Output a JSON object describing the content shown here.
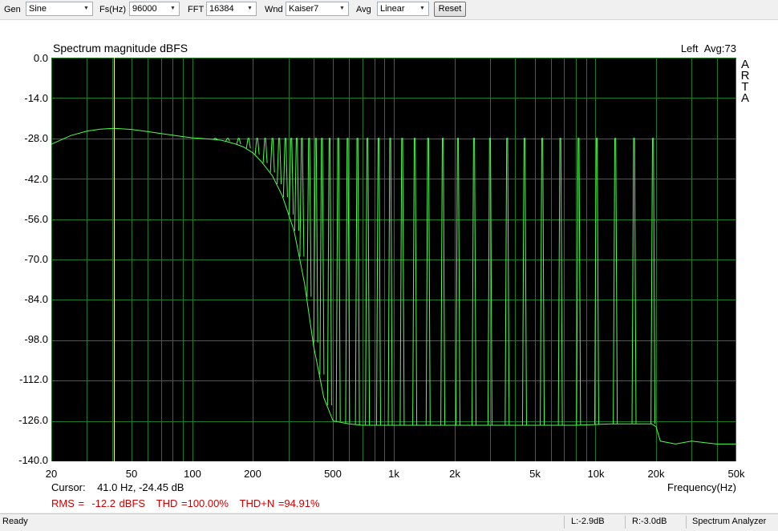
{
  "toolbar": {
    "gen_label": "Gen",
    "gen_value": "Sine",
    "fs_label": "Fs(Hz)",
    "fs_value": "96000",
    "fft_label": "FFT",
    "fft_value": "16384",
    "wnd_label": "Wnd",
    "wnd_value": "Kaiser7",
    "avg_label": "Avg",
    "avg_value": "Linear",
    "reset_label": "Reset"
  },
  "plot": {
    "title": "Spectrum magnitude dBFS",
    "channel": "Left",
    "avg": "Avg:73",
    "logo_letters": [
      "A",
      "R",
      "T",
      "A"
    ],
    "x_axis_label": "Frequency(Hz)",
    "cursor_readout": "Cursor:    41.0 Hz, -24.45 dB",
    "stats": "RMS =  -12.2 dBFS   THD =100.00%   THD+N =94.91%"
  },
  "colors": {
    "plot_bg": "#000000",
    "grid": "#1e7a1e",
    "trace": "#4cff4c",
    "cursor": "#ffff40",
    "stats_text": "#cc0000"
  },
  "chart_data": {
    "type": "line",
    "title": "Spectrum magnitude dBFS",
    "xlabel": "Frequency(Hz)",
    "ylabel": "",
    "x_scale": "log",
    "xlim": [
      20,
      50000
    ],
    "ylim": [
      -140,
      0
    ],
    "grid": true,
    "y_ticks": [
      "0.0",
      "-14.0",
      "-28.0",
      "-42.0",
      "-56.0",
      "-70.0",
      "-84.0",
      "-98.0",
      "-112.0",
      "-126.0",
      "-140.0"
    ],
    "x_ticks": [
      "20",
      "50",
      "100",
      "200",
      "500",
      "1k",
      "2k",
      "5k",
      "10k",
      "20k",
      "50k"
    ],
    "cursor": {
      "freq_hz": 41.0,
      "level_db": -24.45
    },
    "series": [
      {
        "x": [
          20,
          25,
          30,
          35,
          41,
          50,
          60,
          70,
          80,
          90,
          100,
          110,
          120,
          130,
          140,
          150,
          165,
          180,
          200,
          220,
          250,
          280,
          320,
          360,
          400,
          450,
          500,
          600,
          700,
          800,
          1000,
          1200,
          1500,
          2000,
          3000,
          5000,
          8000,
          12000,
          16000,
          19000,
          20000,
          21000,
          25000,
          30000,
          40000,
          50000
        ],
        "y": [
          -30,
          -27,
          -25.5,
          -24.8,
          -24.5,
          -24.9,
          -25.6,
          -26.3,
          -26.9,
          -27.4,
          -27.8,
          -28,
          -28.2,
          -28.4,
          -28.7,
          -29.2,
          -30,
          -31,
          -33,
          -36,
          -41,
          -48,
          -60,
          -78,
          -100,
          -118,
          -126,
          -127,
          -127.5,
          -127.5,
          -127.5,
          -127.5,
          -127.5,
          -127.5,
          -127.5,
          -127.5,
          -127.5,
          -127,
          -127,
          -127,
          -128,
          -133,
          -134,
          -133,
          -134,
          -134
        ]
      }
    ],
    "harmonics_hz": [
      130,
      150,
      170,
      190,
      210,
      230,
      250,
      270,
      290,
      310,
      330,
      350,
      380,
      410,
      440,
      480,
      530,
      590,
      660,
      740,
      840,
      960,
      1100,
      1270,
      1480,
      1750,
      2080,
      2500,
      3000,
      3650,
      4450,
      5450,
      6700,
      8250,
      10150,
      12550,
      15550,
      19300
    ],
    "harmonic_peak_db": -28
  },
  "statusbar": {
    "ready": "Ready",
    "left_level": "L:-2.9dB",
    "right_level": "R:-3.0dB",
    "mode": "Spectrum Analyzer"
  }
}
